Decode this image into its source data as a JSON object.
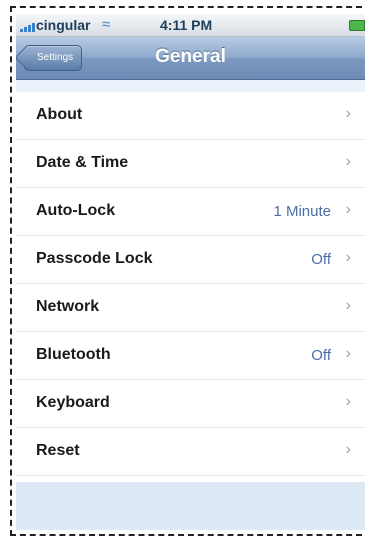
{
  "status_bar": {
    "carrier": "cingular",
    "time": "4:11 PM"
  },
  "nav": {
    "back_label": "Settings",
    "title": "General"
  },
  "rows": [
    {
      "label": "About",
      "value": ""
    },
    {
      "label": "Date & Time",
      "value": ""
    },
    {
      "label": "Auto-Lock",
      "value": "1 Minute"
    },
    {
      "label": "Passcode Lock",
      "value": "Off"
    },
    {
      "label": "Network",
      "value": ""
    },
    {
      "label": "Bluetooth",
      "value": "Off"
    },
    {
      "label": "Keyboard",
      "value": ""
    },
    {
      "label": "Reset",
      "value": ""
    }
  ],
  "icons": {
    "chevron": "chevron-right-icon",
    "wifi": "wifi-icon",
    "signal": "signal-icon",
    "battery": "battery-icon"
  },
  "colors": {
    "nav_bar": "#7b98c0",
    "value_text": "#4a6fa5",
    "battery": "#4cb84c"
  }
}
